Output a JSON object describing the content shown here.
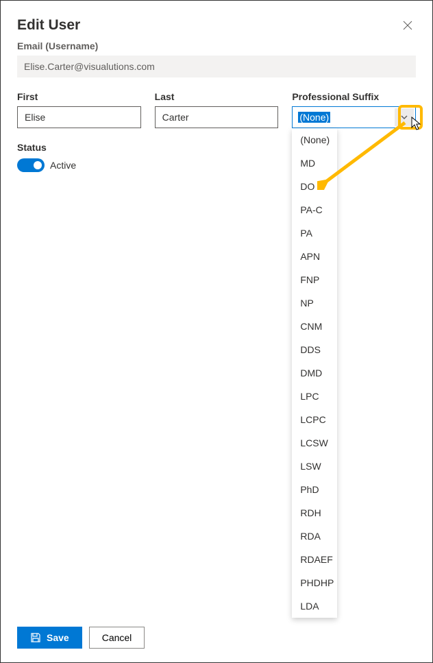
{
  "header": {
    "title": "Edit User"
  },
  "email": {
    "label": "Email (Username)",
    "value": "Elise.Carter@visualutions.com"
  },
  "first": {
    "label": "First",
    "value": "Elise"
  },
  "last": {
    "label": "Last",
    "value": "Carter"
  },
  "suffix": {
    "label": "Professional Suffix",
    "value": "(None)",
    "options": [
      "(None)",
      "MD",
      "DO",
      "PA-C",
      "PA",
      "APN",
      "FNP",
      "NP",
      "CNM",
      "DDS",
      "DMD",
      "LPC",
      "LCPC",
      "LCSW",
      "LSW",
      "PhD",
      "RDH",
      "RDA",
      "RDAEF",
      "PHDHP",
      "LDA"
    ]
  },
  "status": {
    "label": "Status",
    "value_label": "Active"
  },
  "footer": {
    "save": "Save",
    "cancel": "Cancel"
  }
}
